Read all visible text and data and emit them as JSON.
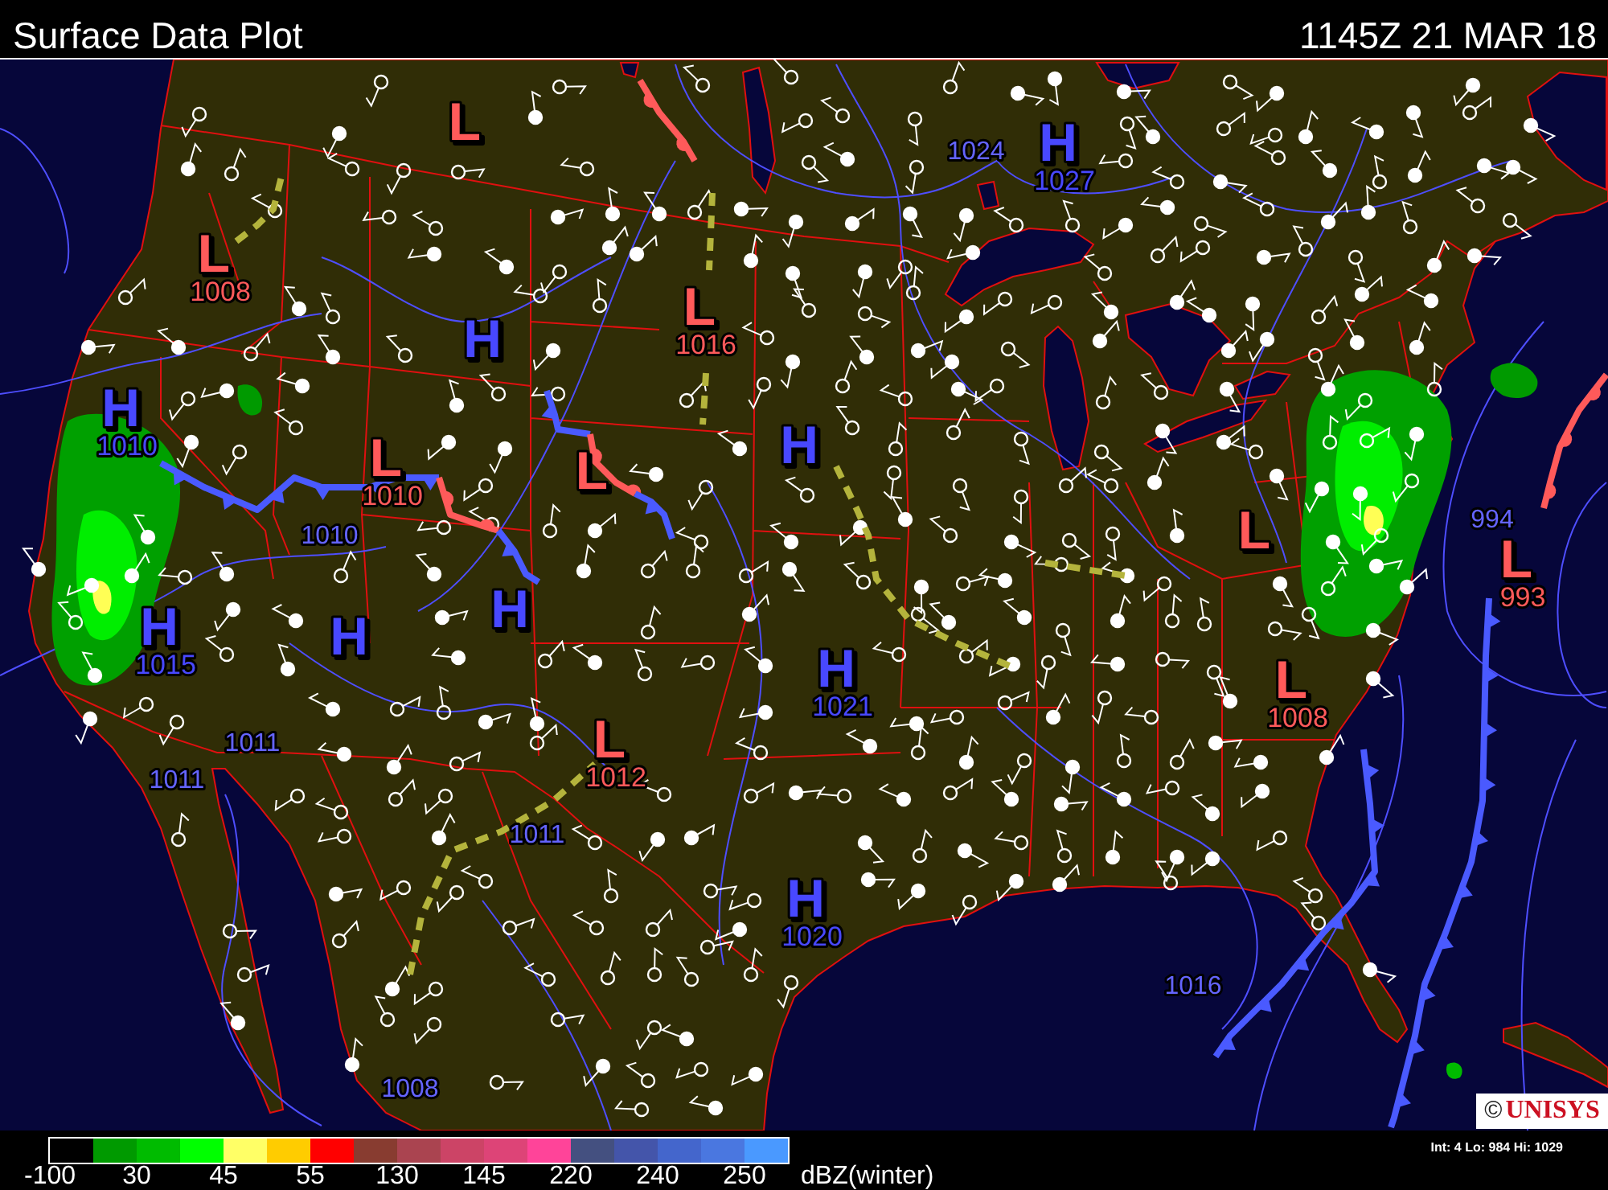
{
  "header": {
    "title": "Surface Data Plot",
    "timestamp": "1145Z 21 MAR 18"
  },
  "map": {
    "pressure_centers": [
      {
        "kind": "low",
        "letter": "L"
      },
      {
        "kind": "high",
        "letter": "H",
        "value": "1027"
      },
      {
        "kind": "low",
        "letter": "L",
        "value": "1008"
      },
      {
        "kind": "high",
        "letter": "H"
      },
      {
        "kind": "low",
        "letter": "L",
        "value": "1016"
      },
      {
        "kind": "high",
        "letter": "H",
        "value": "1010"
      },
      {
        "kind": "low",
        "letter": "L",
        "value": "1010"
      },
      {
        "kind": "low",
        "letter": "L"
      },
      {
        "kind": "high",
        "letter": "H"
      },
      {
        "kind": "low",
        "letter": "L"
      },
      {
        "kind": "low",
        "letter": "L",
        "value": "993"
      },
      {
        "kind": "high",
        "letter": "H",
        "value": "1015"
      },
      {
        "kind": "high",
        "letter": "H"
      },
      {
        "kind": "high",
        "letter": "H"
      },
      {
        "kind": "high",
        "letter": "H",
        "value": "1021"
      },
      {
        "kind": "low",
        "letter": "L",
        "value": "1008"
      },
      {
        "kind": "low",
        "letter": "L",
        "value": "1012"
      },
      {
        "kind": "high",
        "letter": "H",
        "value": "1020"
      }
    ],
    "isobar_labels": [
      "1024",
      "1010",
      "994",
      "1011",
      "1011",
      "1011",
      "1016",
      "1008"
    ],
    "logo": {
      "mark": "©",
      "name": "UNISYS"
    }
  },
  "footer": {
    "color_scale": {
      "swatches": [
        {
          "color": "#000000"
        },
        {
          "color": "#009a00"
        },
        {
          "color": "#00bb00"
        },
        {
          "color": "#00ff00"
        },
        {
          "color": "#ffff66"
        },
        {
          "color": "#ffcc00"
        },
        {
          "color": "#ff0000"
        },
        {
          "color": "#883c30"
        },
        {
          "color": "#aa4450"
        },
        {
          "color": "#cc4466"
        },
        {
          "color": "#dd4477"
        },
        {
          "color": "#ff4499"
        },
        {
          "color": "#445080"
        },
        {
          "color": "#4455aa"
        },
        {
          "color": "#4466cc"
        },
        {
          "color": "#4a77e0"
        },
        {
          "color": "#4a99ff"
        }
      ],
      "labels": [
        "-100",
        "30",
        "45",
        "55",
        "130",
        "145",
        "220",
        "240",
        "250"
      ],
      "unit": "dBZ(winter)"
    },
    "contour_info": "Int: 4 Lo: 984 Hi: 1029"
  }
}
